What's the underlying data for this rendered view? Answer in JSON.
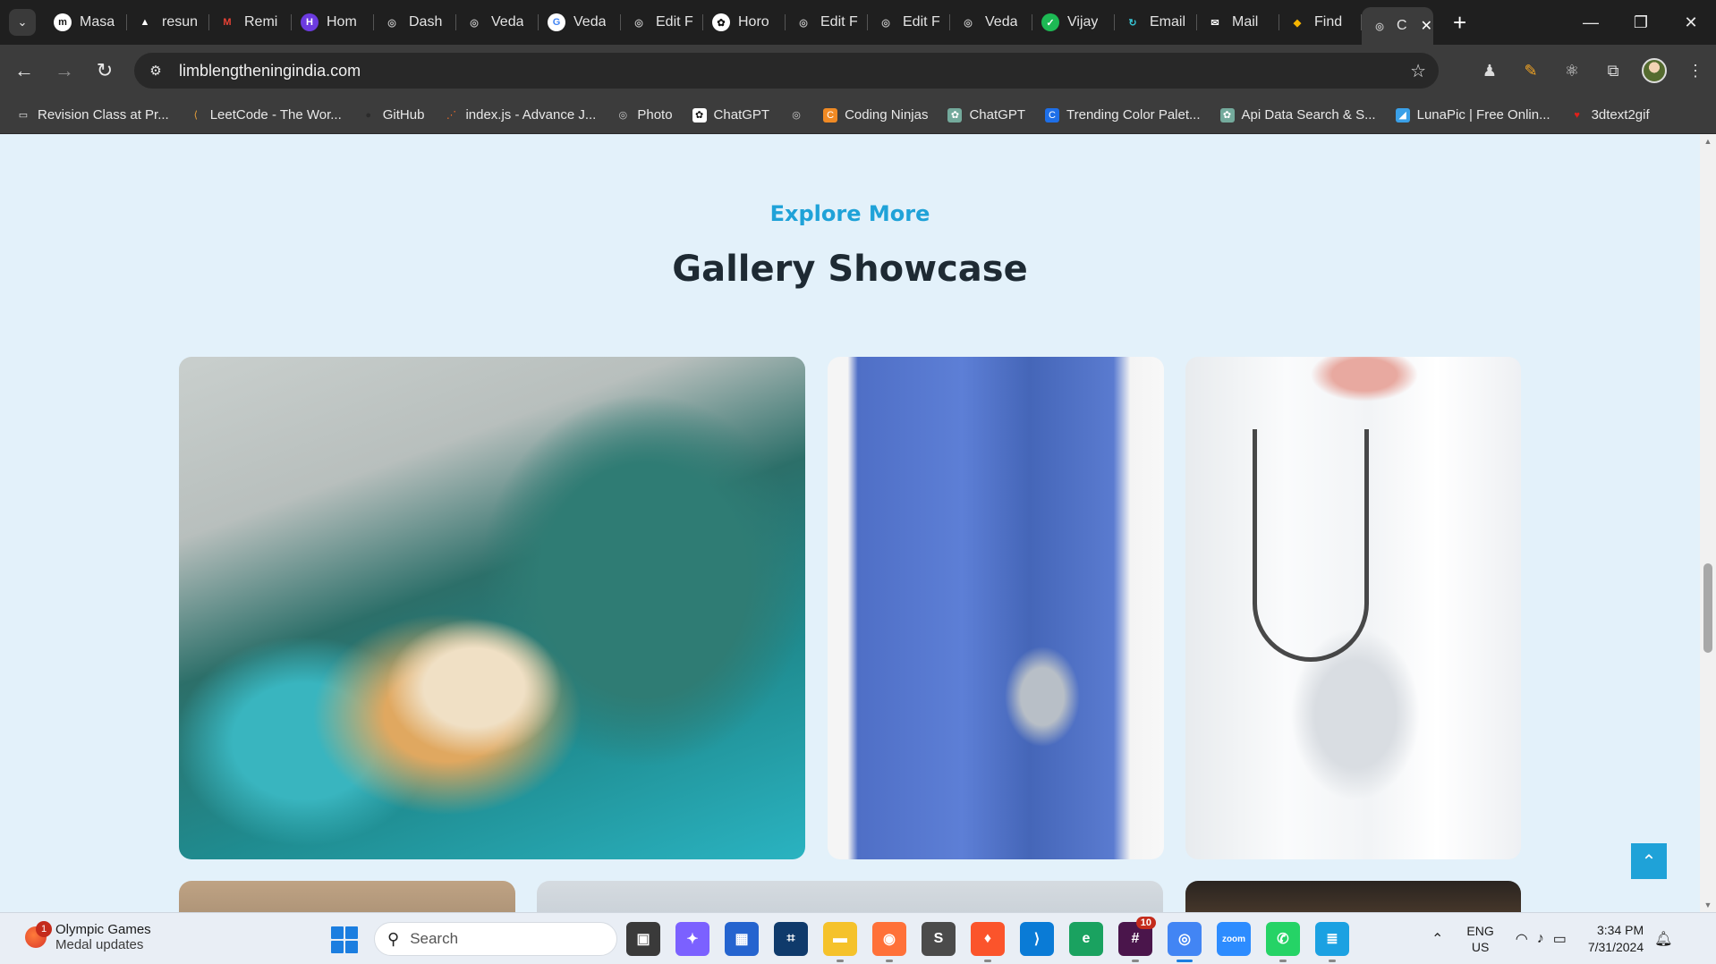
{
  "browser": {
    "tabs": [
      {
        "label": "Masa",
        "icon": "m",
        "color": "#ffffff",
        "fg": "#111"
      },
      {
        "label": "resun",
        "icon": "▲",
        "color": "transparent",
        "fg": "#fff"
      },
      {
        "label": "Remi",
        "icon": "M",
        "color": "transparent",
        "fg": "#e94235"
      },
      {
        "label": "Hom",
        "icon": "H",
        "color": "#6c3be0",
        "fg": "#fff"
      },
      {
        "label": "Dash",
        "icon": "◎",
        "color": "transparent",
        "fg": "#bbb"
      },
      {
        "label": "Veda",
        "icon": "◎",
        "color": "transparent",
        "fg": "#bbb"
      },
      {
        "label": "Veda",
        "icon": "G",
        "color": "#ffffff",
        "fg": "#4285f4"
      },
      {
        "label": "Edit F",
        "icon": "◎",
        "color": "transparent",
        "fg": "#bbb"
      },
      {
        "label": "Horo",
        "icon": "✿",
        "color": "#ffffff",
        "fg": "#111"
      },
      {
        "label": "Edit F",
        "icon": "◎",
        "color": "transparent",
        "fg": "#bbb"
      },
      {
        "label": "Edit F",
        "icon": "◎",
        "color": "transparent",
        "fg": "#bbb"
      },
      {
        "label": "Veda",
        "icon": "◎",
        "color": "transparent",
        "fg": "#bbb"
      },
      {
        "label": "Vijay",
        "icon": "✓",
        "color": "#1db954",
        "fg": "#fff"
      },
      {
        "label": "Email",
        "icon": "↻",
        "color": "transparent",
        "fg": "#38c5d6"
      },
      {
        "label": "Mail",
        "icon": "✉",
        "color": "transparent",
        "fg": "#fff"
      },
      {
        "label": "Find",
        "icon": "◆",
        "color": "transparent",
        "fg": "#f5b400"
      }
    ],
    "active_tab": {
      "label": "C",
      "icon": "◎"
    },
    "url": "limblengtheningindia.com",
    "bookmarks": [
      {
        "label": "Revision Class at Pr...",
        "icon": "▭",
        "color": "transparent",
        "fg": "#e8e8e8"
      },
      {
        "label": "LeetCode - The Wor...",
        "icon": "⟨",
        "color": "transparent",
        "fg": "#f0a43a"
      },
      {
        "label": "GitHub",
        "icon": "●",
        "color": "transparent",
        "fg": "#2b2b2b"
      },
      {
        "label": "index.js - Advance J...",
        "icon": "⋰",
        "color": "transparent",
        "fg": "#ef6c2a"
      },
      {
        "label": "Photo",
        "icon": "◎",
        "color": "transparent",
        "fg": "#ccc"
      },
      {
        "label": "ChatGPT",
        "icon": "✿",
        "color": "#ffffff",
        "fg": "#111"
      },
      {
        "label": "",
        "icon": "◎",
        "color": "transparent",
        "fg": "#ccc"
      },
      {
        "label": "Coding Ninjas",
        "icon": "C",
        "color": "#f08a24",
        "fg": "#fff"
      },
      {
        "label": "ChatGPT",
        "icon": "✿",
        "color": "#74aa9c",
        "fg": "#fff"
      },
      {
        "label": "Trending Color Palet...",
        "icon": "C",
        "color": "#1e6fe8",
        "fg": "#fff"
      },
      {
        "label": "Api Data Search & S...",
        "icon": "✿",
        "color": "#74aa9c",
        "fg": "#fff"
      },
      {
        "label": "LunaPic | Free Onlin...",
        "icon": "◢",
        "color": "#3aa0e8",
        "fg": "#fff"
      },
      {
        "label": "3dtext2gif",
        "icon": "♥",
        "color": "transparent",
        "fg": "#e0201a"
      }
    ]
  },
  "page": {
    "eyebrow": "Explore More",
    "heading": "Gallery Showcase",
    "accent": "#1fa2d8",
    "scroll_top_icon": "chevron-up-icon"
  },
  "taskbar": {
    "weather_title": "Olympic Games",
    "weather_sub": "Medal updates",
    "weather_badge": "1",
    "search_placeholder": "Search",
    "apps": [
      {
        "name": "task-view",
        "glyph": "▣",
        "bg": "#3a3a3a",
        "state": ""
      },
      {
        "name": "copilot",
        "glyph": "✦",
        "bg": "#7b61ff",
        "state": ""
      },
      {
        "name": "microsoft-store",
        "glyph": "▦",
        "bg": "#2564cf",
        "state": ""
      },
      {
        "name": "terminal",
        "glyph": "⌗",
        "bg": "#0f3a6b",
        "state": ""
      },
      {
        "name": "file-explorer",
        "glyph": "▬",
        "bg": "#f5c22b",
        "state": "running"
      },
      {
        "name": "firefox",
        "glyph": "◉",
        "bg": "#ff7139",
        "state": "running"
      },
      {
        "name": "sublime-text",
        "glyph": "S",
        "bg": "#4b4b4b",
        "state": ""
      },
      {
        "name": "brave",
        "glyph": "♦",
        "bg": "#fb542b",
        "state": "running"
      },
      {
        "name": "vscode",
        "glyph": "⟩",
        "bg": "#0a7bd6",
        "state": ""
      },
      {
        "name": "edge",
        "glyph": "e",
        "bg": "#1aa260",
        "state": ""
      },
      {
        "name": "slack",
        "glyph": "#",
        "bg": "#4a154b",
        "state": "running",
        "badge": "10"
      },
      {
        "name": "chrome",
        "glyph": "◎",
        "bg": "#4285f4",
        "state": "active"
      },
      {
        "name": "zoom",
        "glyph": "zoom",
        "bg": "#2d8cff",
        "state": ""
      },
      {
        "name": "whatsapp",
        "glyph": "✆",
        "bg": "#25d366",
        "state": "running"
      },
      {
        "name": "notepad",
        "glyph": "≣",
        "bg": "#1ba1e2",
        "state": "running"
      }
    ],
    "lang_top": "ENG",
    "lang_bottom": "US",
    "time": "3:34 PM",
    "date": "7/31/2024"
  }
}
